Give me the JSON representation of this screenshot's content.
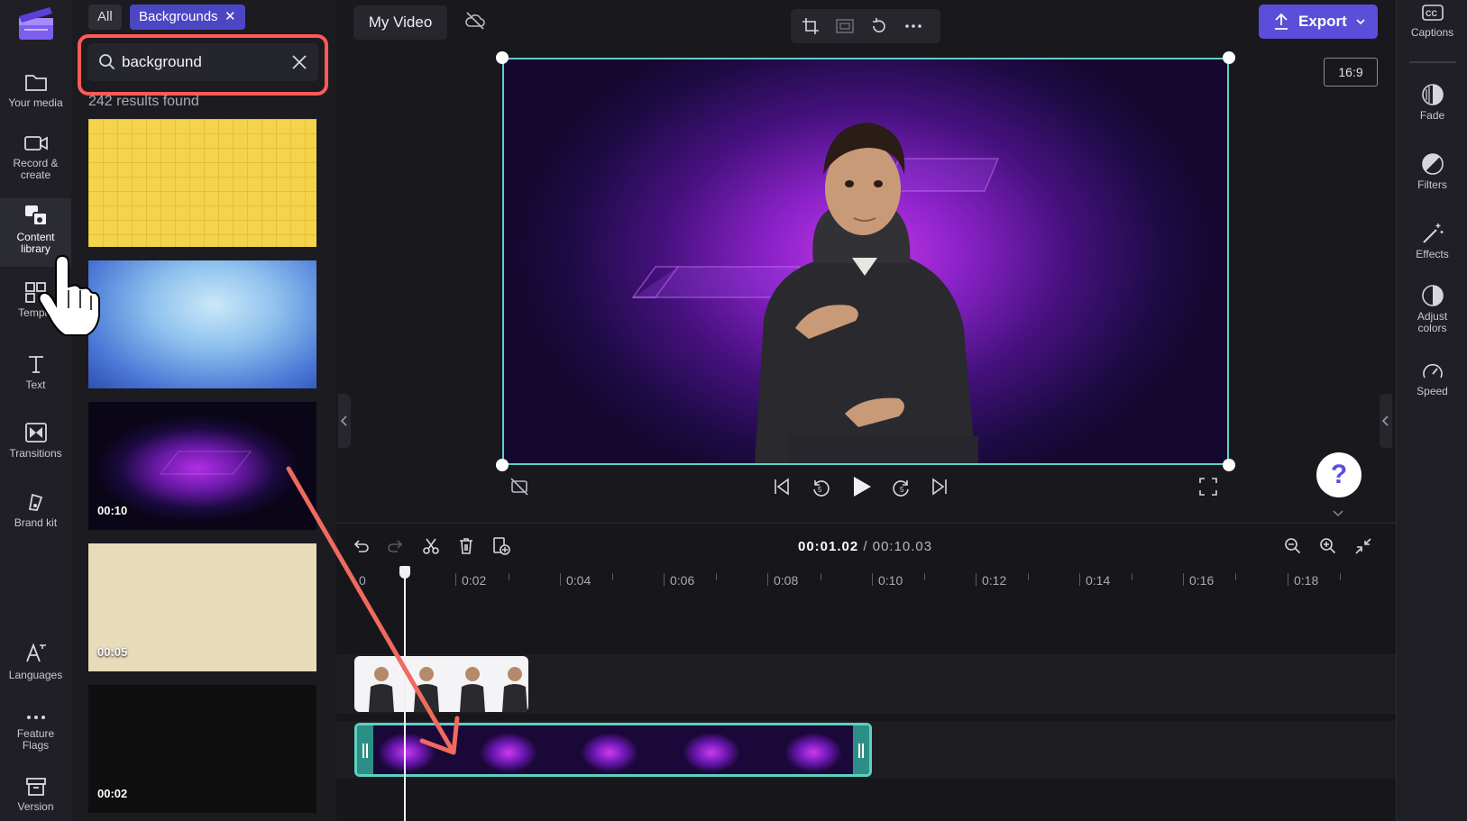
{
  "app": {
    "brand_color": "#5b4ed8",
    "highlight_color": "#ff5a57",
    "accent_teal": "#5fd0c2"
  },
  "left_rail": {
    "items": [
      {
        "label": "Your media",
        "icon": "folder-icon"
      },
      {
        "label": "Record & create",
        "icon": "camera-icon"
      },
      {
        "label": "Content library",
        "icon": "content-library-icon"
      },
      {
        "label": "Templa",
        "icon": "templates-icon"
      },
      {
        "label": "Text",
        "icon": "text-icon"
      },
      {
        "label": "Transitions",
        "icon": "transitions-icon"
      },
      {
        "label": "Brand kit",
        "icon": "brand-kit-icon"
      },
      {
        "label": "Languages",
        "icon": "languages-icon"
      },
      {
        "label": "Feature Flags",
        "icon": "more-icon"
      },
      {
        "label": "Version",
        "icon": "version-icon"
      }
    ]
  },
  "library": {
    "filters": {
      "all": "All",
      "active": "Backgrounds"
    },
    "search": {
      "value": "background",
      "placeholder": "Search"
    },
    "results": "242 results found",
    "thumbnails": [
      {
        "duration": ""
      },
      {
        "duration": ""
      },
      {
        "duration": "00:10"
      },
      {
        "duration": "00:05"
      },
      {
        "duration": "00:02"
      }
    ]
  },
  "topbar": {
    "title": "My Video",
    "export": "Export",
    "aspect": "16:9"
  },
  "timeline": {
    "current": "00:01.02",
    "total": "/ 00:10.03",
    "ruler": [
      "0",
      "0:02",
      "0:04",
      "0:06",
      "0:08",
      "0:10",
      "0:12",
      "0:14",
      "0:16",
      "0:18"
    ]
  },
  "right_rail": {
    "items": [
      {
        "label": "Captions",
        "icon": "captions-icon"
      },
      {
        "label": "Fade",
        "icon": "fade-icon"
      },
      {
        "label": "Filters",
        "icon": "filters-icon"
      },
      {
        "label": "Effects",
        "icon": "effects-icon"
      },
      {
        "label": "Adjust colors",
        "icon": "adjust-colors-icon"
      },
      {
        "label": "Speed",
        "icon": "speed-icon"
      }
    ]
  },
  "help": {
    "label": "?"
  }
}
